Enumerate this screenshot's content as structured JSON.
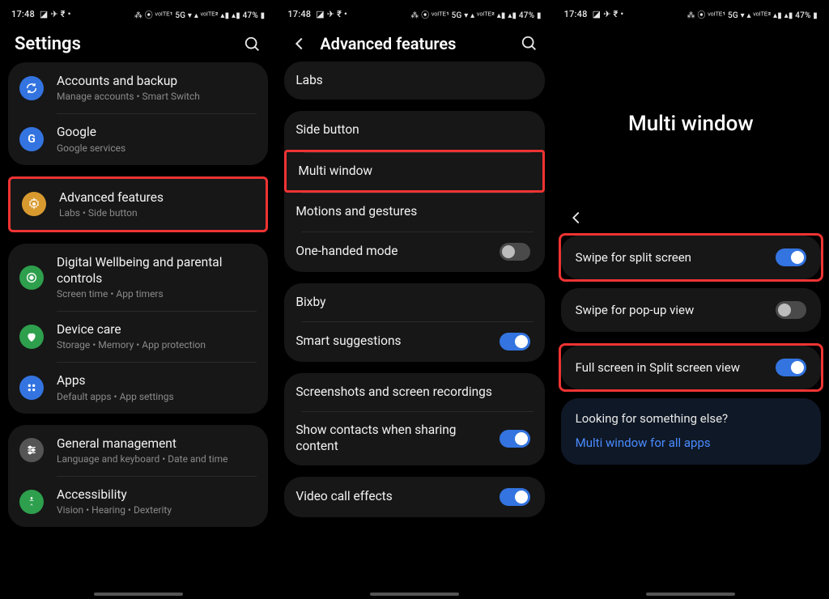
{
  "status": {
    "time": "17:48",
    "left_icons": "◪ ✈ ₹ •",
    "right_cluster": "⁂ ⦿ ᵛᵒᴵᵀᴱ¹ 5G ▾ ▴ ᵛᵒᴵᵀᴱ² ▴▮ ▴▮ 47% ▮"
  },
  "panel1": {
    "title": "Settings",
    "items": {
      "accounts": {
        "title": "Accounts and backup",
        "sub": "Manage accounts  •  Smart Switch"
      },
      "google": {
        "title": "Google",
        "sub": "Google services"
      },
      "advanced": {
        "title": "Advanced features",
        "sub": "Labs  •  Side button"
      },
      "digital": {
        "title": "Digital Wellbeing and parental controls",
        "sub": "Screen time  •  App timers"
      },
      "device": {
        "title": "Device care",
        "sub": "Storage  •  Memory  •  App protection"
      },
      "apps": {
        "title": "Apps",
        "sub": "Default apps  •  App settings"
      },
      "general": {
        "title": "General management",
        "sub": "Language and keyboard  •  Date and time"
      },
      "accessibility": {
        "title": "Accessibility",
        "sub": "Vision  •  Hearing  •  Dexterity"
      }
    }
  },
  "panel2": {
    "title": "Advanced features",
    "items": {
      "labs": "Labs",
      "side_button": "Side button",
      "multi_window": "Multi window",
      "motions": "Motions and gestures",
      "one_handed": "One-handed mode",
      "bixby": "Bixby",
      "smart_suggestions": "Smart suggestions",
      "screenshots": "Screenshots and screen recordings",
      "show_contacts": "Show contacts when sharing content",
      "video_call": "Video call effects"
    },
    "toggles": {
      "one_handed": false,
      "smart_suggestions": true,
      "show_contacts": true,
      "video_call": true
    }
  },
  "panel3": {
    "title": "Multi window",
    "items": {
      "swipe_split": "Swipe for split screen",
      "swipe_popup": "Swipe for pop-up view",
      "full_screen": "Full screen in Split screen view"
    },
    "toggles": {
      "swipe_split": true,
      "swipe_popup": false,
      "full_screen": true
    },
    "info_title": "Looking for something else?",
    "info_link": "Multi window for all apps"
  }
}
